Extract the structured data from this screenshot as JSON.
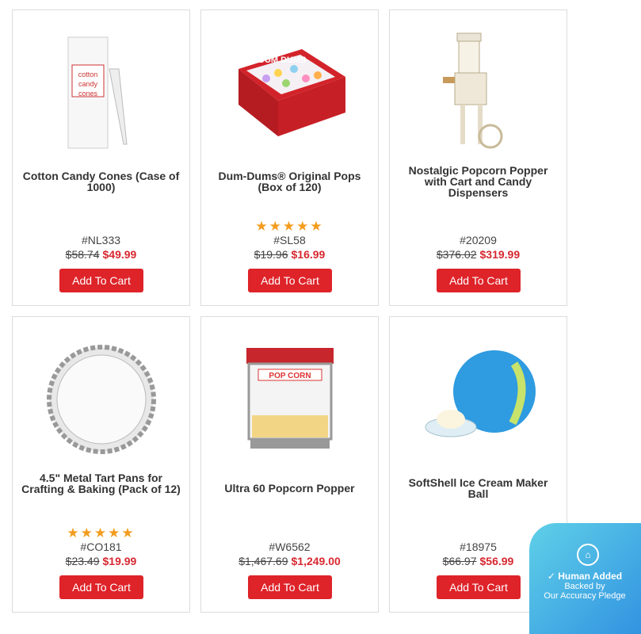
{
  "products": [
    {
      "title": "Cotton Candy Cones (Case of 1000)",
      "sku": "#NL333",
      "old_price": "$58.74",
      "price": "$49.99",
      "rating": null
    },
    {
      "title": "Dum-Dums® Original Pops (Box of 120)",
      "sku": "#SL58",
      "old_price": "$19.96",
      "price": "$16.99",
      "rating": "★★★★★"
    },
    {
      "title": "Nostalgic Popcorn Popper with Cart and Candy Dispensers",
      "sku": "#20209",
      "old_price": "$376.02",
      "price": "$319.99",
      "rating": null
    },
    {
      "title": "4.5\" Metal Tart Pans for Crafting & Baking (Pack of 12)",
      "sku": "#CO181",
      "old_price": "$23.49",
      "price": "$19.99",
      "rating": "★★★★★"
    },
    {
      "title": "Ultra 60 Popcorn Popper",
      "sku": "#W6562",
      "old_price": "$1,467.69",
      "price": "$1,249.00",
      "rating": null
    },
    {
      "title": "SoftShell Ice Cream Maker Ball",
      "sku": "#18975",
      "old_price": "$66.97",
      "price": "$56.99",
      "rating": null
    }
  ],
  "add_to_cart_label": "Add To Cart",
  "badge": {
    "title": "Human Added",
    "line1": "Backed by",
    "line2": "Our Accuracy Pledge"
  }
}
